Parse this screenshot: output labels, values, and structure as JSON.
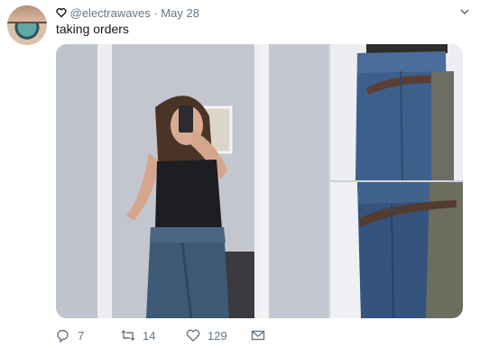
{
  "tweet": {
    "handle": "@electrawaves",
    "separator": "·",
    "date": "May 28",
    "text": "taking orders",
    "badge_icon": "heart-outline-icon",
    "menu_icon": "chevron-down-icon"
  },
  "media": {
    "main_photo": "mirror-selfie-photo",
    "side_photo_top": "jeans-on-hanger-photo",
    "side_photo_bottom": "jeans-and-khaki-photo"
  },
  "actions": {
    "reply_count": "7",
    "retweet_count": "14",
    "like_count": "129",
    "reply_icon": "reply-icon",
    "retweet_icon": "retweet-icon",
    "like_icon": "heart-icon",
    "dm_icon": "envelope-icon"
  },
  "colors": {
    "text_primary": "#14171a",
    "text_secondary": "#657786"
  }
}
